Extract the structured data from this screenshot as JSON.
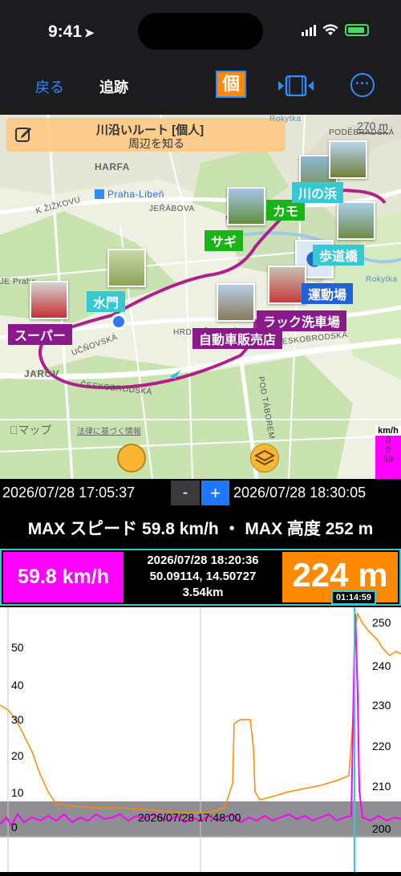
{
  "status": {
    "time": "9:41"
  },
  "nav": {
    "back": "戻る",
    "title": "追跡",
    "personal": "個",
    "more": "···"
  },
  "map": {
    "banner_title": "川沿いルート [個人]",
    "banner_sub": "周辺を知る",
    "scale": "270 m",
    "streets": [
      "PODĚBRADSKÁ",
      "HARFA",
      "Praha-Libeň",
      "K ŽIŽKOVU",
      "JEŘÁBOVA",
      "JE Praha",
      "UČŇOVSKÁ",
      "HRDLOŘEZSKÁ",
      "JAROV",
      "ČESKOBRODSKÁ",
      "ČESKOBRODSKÁ",
      "POD TÁBOREM",
      "Rokytka",
      "Rokytka"
    ],
    "labels": [
      "水門",
      "サギ",
      "カモ",
      "歩道橋",
      "運動場",
      "スーパー",
      "自動車販売店",
      "ラック洗車場",
      "川の浜"
    ],
    "maps_logo": "マップ",
    "legal": "法律に基づく情報",
    "legend_head": "km/h",
    "legend_values": [
      "0",
      "5",
      "59"
    ]
  },
  "timeline": {
    "start": "2026/07/28 17:05:37",
    "minus": "-",
    "plus": "+",
    "end": "2026/07/28 18:30:05"
  },
  "max_summary": "MAX スピード 59.8 km/h ・ MAX 高度 252 m",
  "info": {
    "speed": "59.8 km/h",
    "datetime": "2026/07/28 18:20:36",
    "coords": "50.09114, 14.50727",
    "distance": "3.54km",
    "altitude": "224 m",
    "duration": "01:14:59"
  },
  "graph": {
    "left_axis": [
      "50",
      "40",
      "30",
      "20",
      "10",
      "0"
    ],
    "right_axis": [
      "250",
      "240",
      "230",
      "220",
      "210",
      "200"
    ],
    "cursor_time": "2026/07/28 17:48:00",
    "colors": {
      "speed": "#ff00ff",
      "altitude": "#ff8a00"
    }
  }
}
